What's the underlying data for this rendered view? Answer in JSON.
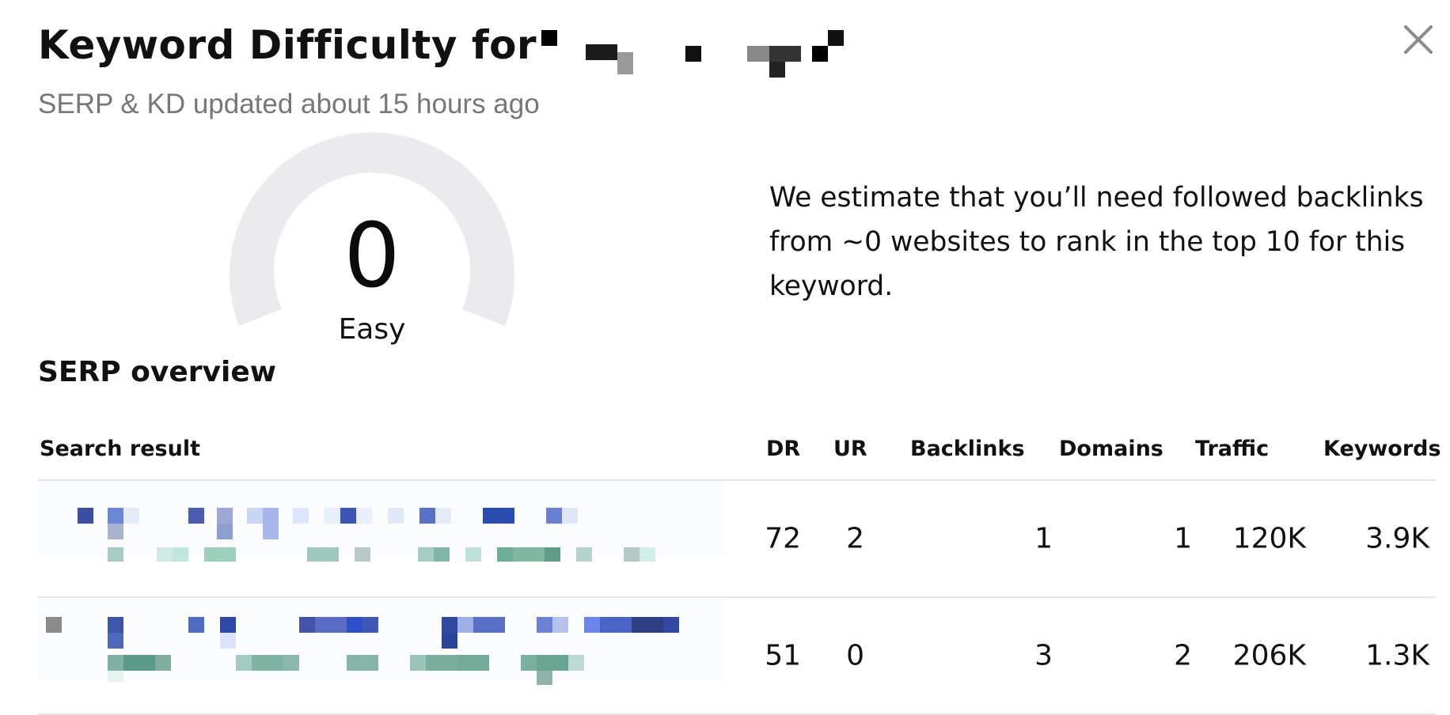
{
  "dialog": {
    "title": "Keyword Difficulty for",
    "subtitle": "SERP & KD updated about 15 hours ago",
    "close_icon": "close-icon"
  },
  "gauge": {
    "value": "0",
    "label": "Easy",
    "track_color": "#ebebed"
  },
  "estimate_text": "We estimate that you’ll need followed backlinks from ~0 websites to rank in the top 10 for this keyword.",
  "serp": {
    "section_title": "SERP overview",
    "columns": [
      "Search result",
      "DR",
      "UR",
      "Backlinks",
      "Domains",
      "Traffic",
      "Keywords"
    ],
    "rows": [
      {
        "dr": "72",
        "ur": "2",
        "backlinks": "1",
        "domains": "1",
        "traffic": "120K",
        "keywords": "3.9K"
      },
      {
        "dr": "51",
        "ur": "0",
        "backlinks": "3",
        "domains": "2",
        "traffic": "206K",
        "keywords": "1.3K"
      }
    ]
  }
}
